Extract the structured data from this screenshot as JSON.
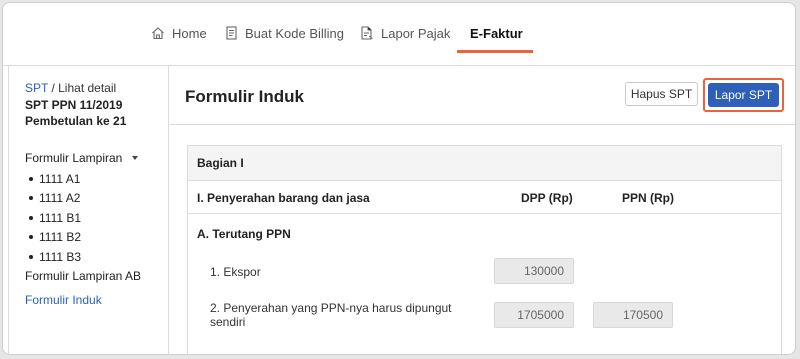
{
  "nav": {
    "items": [
      {
        "label": "Home",
        "icon": "home-icon"
      },
      {
        "label": "Buat Kode Billing",
        "icon": "document-icon"
      },
      {
        "label": "Lapor Pajak",
        "icon": "report-icon"
      },
      {
        "label": "E-Faktur",
        "active": true
      }
    ],
    "accent_color": "#e8643c"
  },
  "sidebar": {
    "breadcrumb_link": "SPT",
    "breadcrumb_rest": " / Lihat detail",
    "spt_title": "SPT PPN 11/2019",
    "spt_subtitle": "Pembetulan ke 21",
    "lampiran_label": "Formulir Lampiran",
    "lampiran_items": [
      "1111 A1",
      "1111 A2",
      "1111 B1",
      "1111 B2",
      "1111 B3"
    ],
    "lampiran_ab": "Formulir Lampiran AB",
    "induk_link": "Formulir Induk"
  },
  "main": {
    "title": "Formulir Induk",
    "hapus_label": "Hapus SPT",
    "lapor_label": "Lapor SPT",
    "section_title": "Bagian I",
    "col_desc": "I. Penyerahan barang dan jasa",
    "col_dpp": "DPP (Rp)",
    "col_ppn": "PPN (Rp)",
    "group_a": "A. Terutang PPN",
    "rows": [
      {
        "label": "1. Ekspor",
        "dpp": "130000",
        "ppn": ""
      },
      {
        "label": "2. Penyerahan yang PPN-nya harus dipungut sendiri",
        "dpp": "1705000",
        "ppn": "170500"
      }
    ],
    "primary_color": "#2e5fb9"
  }
}
